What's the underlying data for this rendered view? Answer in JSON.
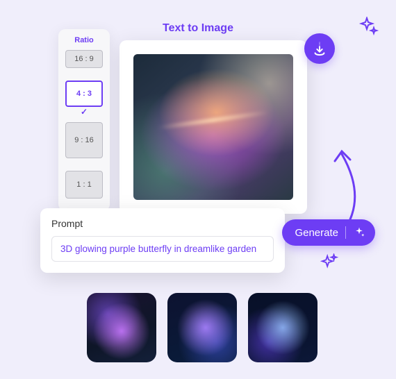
{
  "title": "Text to Image",
  "ratio": {
    "label": "Ratio",
    "options": [
      "16 : 9",
      "4 : 3",
      "9 : 16",
      "1 : 1"
    ],
    "selected": "4 : 3"
  },
  "prompt": {
    "label": "Prompt",
    "value": "3D glowing purple butterfly in dreamlike garden"
  },
  "actions": {
    "generate": "Generate",
    "download": "download"
  },
  "icons": {
    "sparkle": "sparkle-icon",
    "download": "download-icon",
    "wand": "wand-sparkle-icon",
    "arrow": "curved-arrow-icon"
  },
  "colors": {
    "accent": "#6d3df4",
    "bg": "#f0eefb"
  }
}
